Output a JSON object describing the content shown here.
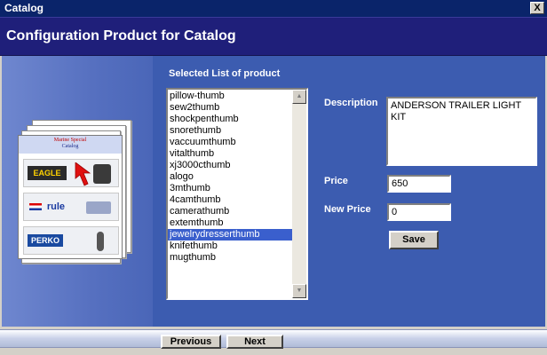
{
  "window": {
    "title": "Catalog",
    "close_glyph": "X"
  },
  "header": {
    "title": "Configuration Product for Catalog"
  },
  "illustration": {
    "catalog_title": "Marine Special",
    "catalog_subtitle": "Catalog",
    "brands": [
      "EAGLE",
      "rule",
      "PERKO"
    ]
  },
  "product_list": {
    "label": "Selected List of product",
    "items": [
      "pillow-thumb",
      "sew2thumb",
      "shockpenthumb",
      "snorethumb",
      "vaccuumthumb",
      "vitalthumb",
      "xj3000cthumb",
      "alogo",
      "3mthumb",
      "4camthumb",
      "camerathumb",
      "extemthumb",
      "jewelrydresserthumb",
      "knifethumb",
      "mugthumb"
    ],
    "selected_index": 12
  },
  "details": {
    "description_label": "Description",
    "description_value": "ANDERSON TRAILER LIGHT KIT",
    "price_label": "Price",
    "price_value": "650",
    "new_price_label": "New Price",
    "new_price_value": "0",
    "save_label": "Save"
  },
  "footer": {
    "previous_label": "Previous",
    "next_label": "Next"
  },
  "colors": {
    "title_bar": "#0a246a",
    "header": "#1f1f7a",
    "content": "#3c5cb0",
    "selection": "#3a5fcd"
  }
}
